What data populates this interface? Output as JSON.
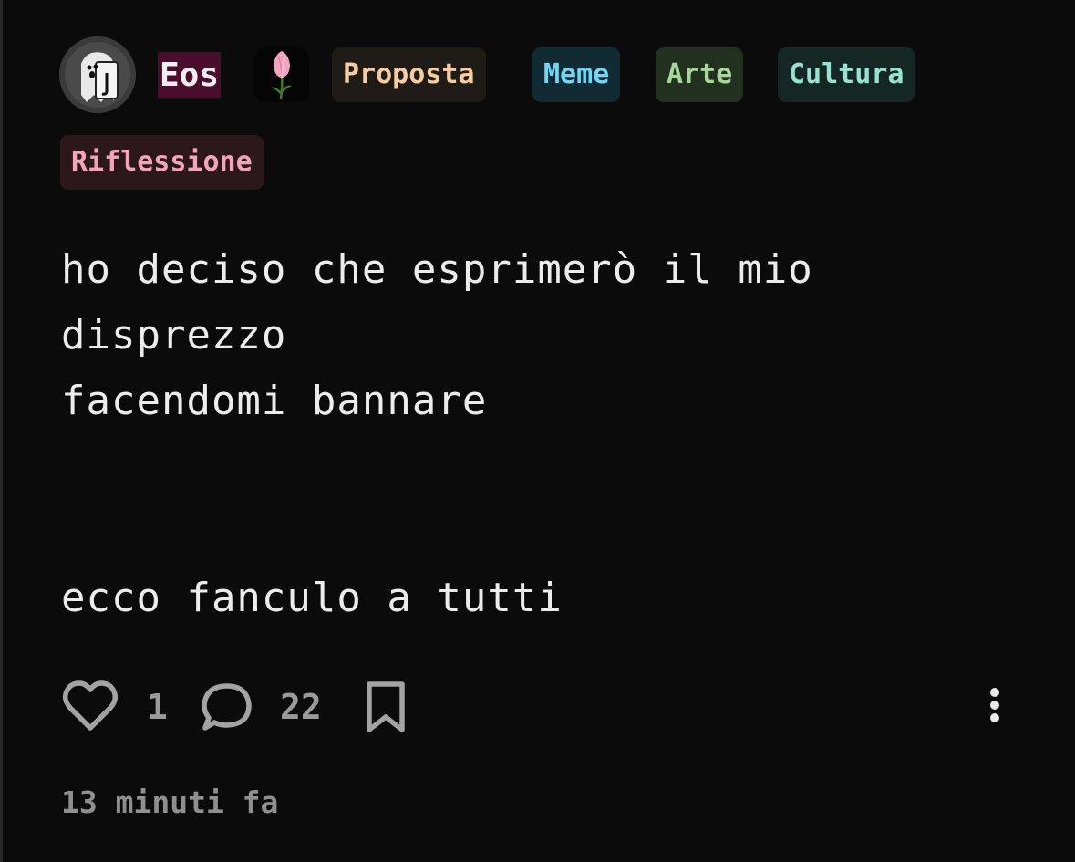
{
  "author": {
    "name": "Eos"
  },
  "tags": [
    "Proposta",
    "Meme",
    "Arte",
    "Cultura",
    "Riflessione"
  ],
  "post": {
    "lines": [
      "ho deciso che esprimerò il mio",
      "disprezzo",
      "facendomi bannare",
      "",
      "",
      "ecco fanculo a tutti"
    ]
  },
  "actions": {
    "likes": "1",
    "comments": "22"
  },
  "timestamp": "13 minuti fa",
  "colors": {
    "background": "#0b0b0b",
    "username_highlight": "#4a0d2c",
    "tag_proposta": "#f6cda2",
    "tag_meme": "#74d5f4",
    "tag_arte": "#a9d69a",
    "tag_cultura": "#98e2cf",
    "tag_riflessione": "#f3a4bb",
    "icon_gray": "#a3a3a3"
  },
  "icons": [
    "user-avatar",
    "tulip-flair-icon",
    "heart-icon",
    "comment-bubble-icon",
    "bookmark-icon",
    "more-vertical-icon"
  ]
}
